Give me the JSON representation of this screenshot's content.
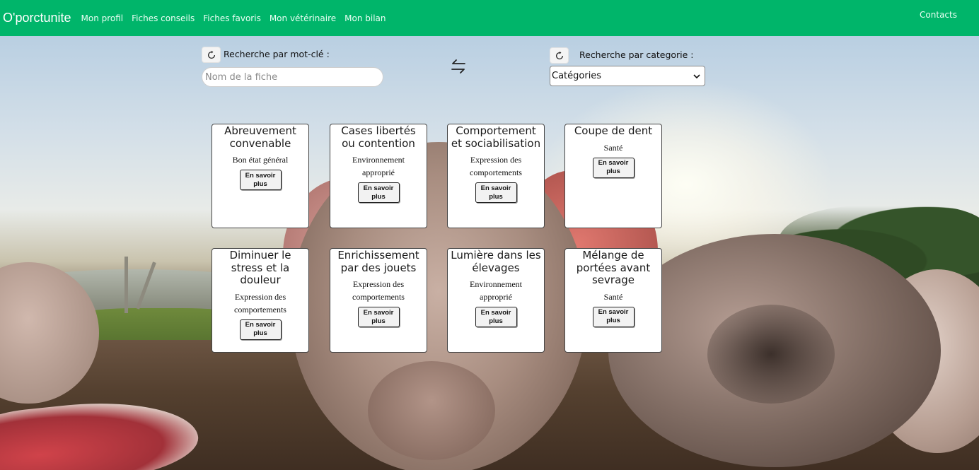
{
  "navbar": {
    "brand": "O'porctunite",
    "links": [
      "Mon profil",
      "Fiches conseils",
      "Fiches favoris",
      "Mon vétérinaire",
      "Mon bilan"
    ],
    "contacts": "Contacts",
    "color": "#00b56a"
  },
  "search": {
    "keyword_label": "Recherche par mot-clé :",
    "keyword_placeholder": "Nom de la fiche",
    "category_label": "Recherche par categorie :",
    "category_selected": "Catégories"
  },
  "cards": [
    {
      "title": "Abreuvement convenable",
      "category": "Bon état général",
      "button": "En savoir plus"
    },
    {
      "title": "Cases libertés ou contention",
      "category": "Environnement approprié",
      "button": "En savoir plus"
    },
    {
      "title": "Comportement et sociabilisation",
      "category": "Expression des comportements",
      "button": "En savoir plus"
    },
    {
      "title": "Coupe de dent",
      "category": "Santé",
      "button": "En savoir plus"
    },
    {
      "title": "Diminuer le stress et la douleur",
      "category": "Expression des comportements",
      "button": "En savoir plus"
    },
    {
      "title": "Enrichissement par des jouets",
      "category": "Expression des comportements",
      "button": "En savoir plus"
    },
    {
      "title": "Lumière dans les élevages",
      "category": "Environnement approprié",
      "button": "En savoir plus"
    },
    {
      "title": "Mélange de portées avant sevrage",
      "category": "Santé",
      "button": "En savoir plus"
    }
  ]
}
